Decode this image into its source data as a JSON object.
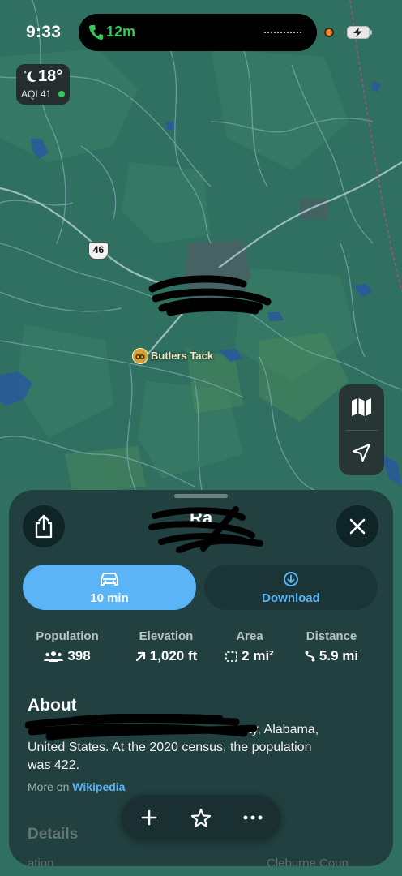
{
  "status_bar": {
    "time": "9:33",
    "call_timer": "12m",
    "call_color": "#34c759"
  },
  "weather": {
    "temperature": "18°",
    "aqi": "AQI 41",
    "icon": "moon-stars-icon"
  },
  "map": {
    "route_shield": "46",
    "poi_label": "Butlers Tack",
    "controls": [
      "map-mode-icon",
      "location-arrow-icon"
    ]
  },
  "sheet": {
    "title": "Ra",
    "actions": {
      "drive_label": "10 min",
      "download_label": "Download"
    },
    "stats": [
      {
        "label": "Population",
        "value": "398",
        "icon": "people-icon"
      },
      {
        "label": "Elevation",
        "value": "1,020 ft",
        "icon": "arrow-up-right-icon"
      },
      {
        "label": "Area",
        "value": "2 mi²",
        "icon": "dashed-square-icon"
      },
      {
        "label": "Distance",
        "value": "5.9 mi",
        "icon": "route-icon"
      }
    ],
    "about": {
      "heading": "About",
      "line1_visible": "ounty, Alabama,",
      "line1_partial": "anbu",
      "line2": "United States. At the 2020 census, the population",
      "line3": "was 422.",
      "more_on_prefix": "More on ",
      "more_on_link": "Wikipedia"
    },
    "details": {
      "heading": "Details",
      "left_faded": "ation",
      "county_faded": "Cleburne Coun"
    },
    "toolbar": [
      "plus-icon",
      "star-icon",
      "more-icon"
    ]
  },
  "colors": {
    "accent": "#5ab4f5",
    "sheet_bg": "#21403f",
    "map_bg": "#2f7060"
  }
}
